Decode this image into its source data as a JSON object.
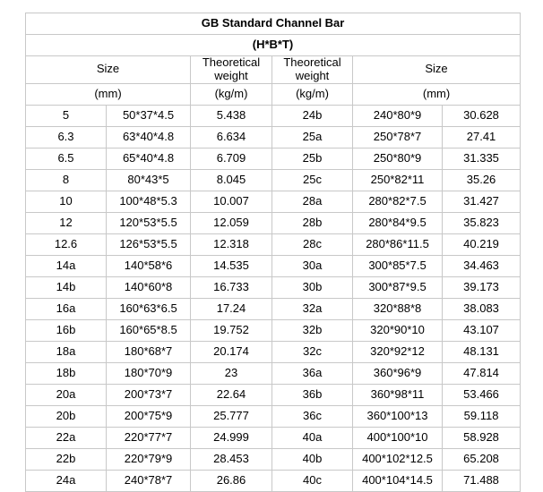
{
  "title": "GB Standard Channel Bar",
  "subtitle": "(H*B*T)",
  "colors": {
    "header_background": "#dce1ec",
    "border": "#c8c8c8",
    "text": "#000000",
    "cell_background": "#ffffff"
  },
  "headers": {
    "size_left": "Size",
    "weight_left": "Theoretical weight",
    "weight_right": "Theoretical weight",
    "size_right": "Size",
    "unit_size_left": "(mm)",
    "unit_weight_left": "(kg/m)",
    "unit_weight_right": "(kg/m)",
    "unit_size_right": "(mm)"
  },
  "rows": [
    {
      "l_desig": "5",
      "l_dim": "50*37*4.5",
      "l_wt": "5.438",
      "r_desig": "24b",
      "r_dim": "240*80*9",
      "r_wt": "30.628"
    },
    {
      "l_desig": "6.3",
      "l_dim": "63*40*4.8",
      "l_wt": "6.634",
      "r_desig": "25a",
      "r_dim": "250*78*7",
      "r_wt": "27.41"
    },
    {
      "l_desig": "6.5",
      "l_dim": "65*40*4.8",
      "l_wt": "6.709",
      "r_desig": "25b",
      "r_dim": "250*80*9",
      "r_wt": "31.335"
    },
    {
      "l_desig": "8",
      "l_dim": "80*43*5",
      "l_wt": "8.045",
      "r_desig": "25c",
      "r_dim": "250*82*11",
      "r_wt": "35.26"
    },
    {
      "l_desig": "10",
      "l_dim": "100*48*5.3",
      "l_wt": "10.007",
      "r_desig": "28a",
      "r_dim": "280*82*7.5",
      "r_wt": "31.427"
    },
    {
      "l_desig": "12",
      "l_dim": "120*53*5.5",
      "l_wt": "12.059",
      "r_desig": "28b",
      "r_dim": "280*84*9.5",
      "r_wt": "35.823"
    },
    {
      "l_desig": "12.6",
      "l_dim": "126*53*5.5",
      "l_wt": "12.318",
      "r_desig": "28c",
      "r_dim": "280*86*11.5",
      "r_wt": "40.219"
    },
    {
      "l_desig": "14a",
      "l_dim": "140*58*6",
      "l_wt": "14.535",
      "r_desig": "30a",
      "r_dim": "300*85*7.5",
      "r_wt": "34.463"
    },
    {
      "l_desig": "14b",
      "l_dim": "140*60*8",
      "l_wt": "16.733",
      "r_desig": "30b",
      "r_dim": "300*87*9.5",
      "r_wt": "39.173"
    },
    {
      "l_desig": "16a",
      "l_dim": "160*63*6.5",
      "l_wt": "17.24",
      "r_desig": "32a",
      "r_dim": "320*88*8",
      "r_wt": "38.083"
    },
    {
      "l_desig": "16b",
      "l_dim": "160*65*8.5",
      "l_wt": "19.752",
      "r_desig": "32b",
      "r_dim": "320*90*10",
      "r_wt": "43.107"
    },
    {
      "l_desig": "18a",
      "l_dim": "180*68*7",
      "l_wt": "20.174",
      "r_desig": "32c",
      "r_dim": "320*92*12",
      "r_wt": "48.131"
    },
    {
      "l_desig": "18b",
      "l_dim": "180*70*9",
      "l_wt": "23",
      "r_desig": "36a",
      "r_dim": "360*96*9",
      "r_wt": "47.814"
    },
    {
      "l_desig": "20a",
      "l_dim": "200*73*7",
      "l_wt": "22.64",
      "r_desig": "36b",
      "r_dim": "360*98*11",
      "r_wt": "53.466"
    },
    {
      "l_desig": "20b",
      "l_dim": "200*75*9",
      "l_wt": "25.777",
      "r_desig": "36c",
      "r_dim": "360*100*13",
      "r_wt": "59.118"
    },
    {
      "l_desig": "22a",
      "l_dim": "220*77*7",
      "l_wt": "24.999",
      "r_desig": "40a",
      "r_dim": "400*100*10",
      "r_wt": "58.928"
    },
    {
      "l_desig": "22b",
      "l_dim": "220*79*9",
      "l_wt": "28.453",
      "r_desig": "40b",
      "r_dim": "400*102*12.5",
      "r_wt": "65.208"
    },
    {
      "l_desig": "24a",
      "l_dim": "240*78*7",
      "l_wt": "26.86",
      "r_desig": "40c",
      "r_dim": "400*104*14.5",
      "r_wt": "71.488"
    }
  ]
}
